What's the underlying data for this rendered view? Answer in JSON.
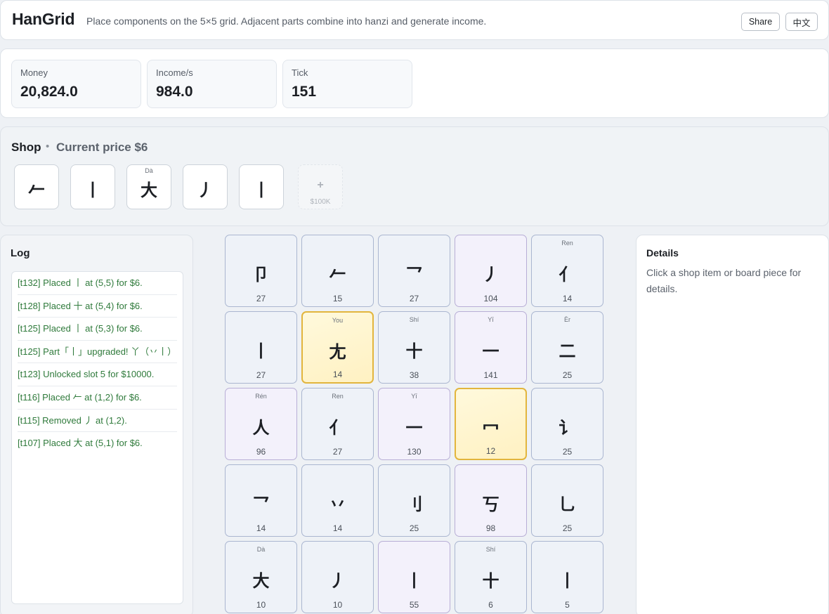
{
  "header": {
    "title": "HanGrid",
    "subtitle": "Place components on the 5×5 grid. Adjacent parts combine into hanzi and generate income.",
    "share_label": "Share",
    "lang_label": "中文"
  },
  "stats": [
    {
      "label": "Money",
      "value": "20,824.0"
    },
    {
      "label": "Income/s",
      "value": "984.0"
    },
    {
      "label": "Tick",
      "value": "151"
    }
  ],
  "shop": {
    "title": "Shop",
    "separator": "•",
    "price_label": "Current price $6",
    "items": [
      {
        "glyph": "𠂉",
        "pinyin": ""
      },
      {
        "glyph": "丨",
        "pinyin": ""
      },
      {
        "glyph": "大",
        "pinyin": "Dà"
      },
      {
        "glyph": "丿",
        "pinyin": ""
      },
      {
        "glyph": "丨",
        "pinyin": ""
      }
    ],
    "expand": {
      "icon": "+",
      "price": "$100K"
    }
  },
  "log": {
    "title": "Log",
    "entries": [
      "[t132] Placed 丨 at (5,5) for $6.",
      "[t128] Placed 十 at (5,4) for $6.",
      "[t125] Placed 丨 at (5,3) for $6.",
      "[t125] Part「丨」upgraded! 丫（丷丨）",
      "[t123] Unlocked slot 5 for $10000.",
      "[t116] Placed 𠂉 at (1,2) for $6.",
      "[t115] Removed 丿 at (1,2).",
      "[t107] Placed 大 at (5,1) for $6."
    ]
  },
  "board": {
    "rows": [
      [
        {
          "glyph": "卩",
          "pinyin": "",
          "count": "27",
          "style": "blue"
        },
        {
          "glyph": "𠂉",
          "pinyin": "",
          "count": "15",
          "style": "blue"
        },
        {
          "glyph": "乛",
          "pinyin": "",
          "count": "27",
          "style": "blue"
        },
        {
          "glyph": "丿",
          "pinyin": "",
          "count": "104",
          "style": "purple"
        },
        {
          "glyph": "亻",
          "pinyin": "Ren",
          "count": "14",
          "style": "blue"
        }
      ],
      [
        {
          "glyph": "丨",
          "pinyin": "",
          "count": "27",
          "style": "blue"
        },
        {
          "glyph": "尢",
          "pinyin": "You",
          "count": "14",
          "style": "gold"
        },
        {
          "glyph": "十",
          "pinyin": "Shí",
          "count": "38",
          "style": "blue"
        },
        {
          "glyph": "一",
          "pinyin": "Yī",
          "count": "141",
          "style": "purple"
        },
        {
          "glyph": "二",
          "pinyin": "Èr",
          "count": "25",
          "style": "blue"
        }
      ],
      [
        {
          "glyph": "人",
          "pinyin": "Rén",
          "count": "96",
          "style": "purple"
        },
        {
          "glyph": "亻",
          "pinyin": "Ren",
          "count": "27",
          "style": "blue"
        },
        {
          "glyph": "一",
          "pinyin": "Yī",
          "count": "130",
          "style": "purple"
        },
        {
          "glyph": "冖",
          "pinyin": "",
          "count": "12",
          "style": "gold"
        },
        {
          "glyph": "讠",
          "pinyin": "",
          "count": "25",
          "style": "blue"
        }
      ],
      [
        {
          "glyph": "乛",
          "pinyin": "",
          "count": "14",
          "style": "blue"
        },
        {
          "glyph": "丷",
          "pinyin": "",
          "count": "14",
          "style": "blue"
        },
        {
          "glyph": "刂",
          "pinyin": "",
          "count": "25",
          "style": "blue"
        },
        {
          "glyph": "丂",
          "pinyin": "",
          "count": "98",
          "style": "purple"
        },
        {
          "glyph": "乚",
          "pinyin": "",
          "count": "25",
          "style": "blue"
        }
      ],
      [
        {
          "glyph": "大",
          "pinyin": "Dà",
          "count": "10",
          "style": "blue"
        },
        {
          "glyph": "丿",
          "pinyin": "",
          "count": "10",
          "style": "blue"
        },
        {
          "glyph": "丨",
          "pinyin": "",
          "count": "55",
          "style": "purple"
        },
        {
          "glyph": "十",
          "pinyin": "Shí",
          "count": "6",
          "style": "blue"
        },
        {
          "glyph": "丨",
          "pinyin": "",
          "count": "5",
          "style": "blue"
        }
      ]
    ]
  },
  "details": {
    "title": "Details",
    "text": "Click a shop item or board piece for details."
  }
}
